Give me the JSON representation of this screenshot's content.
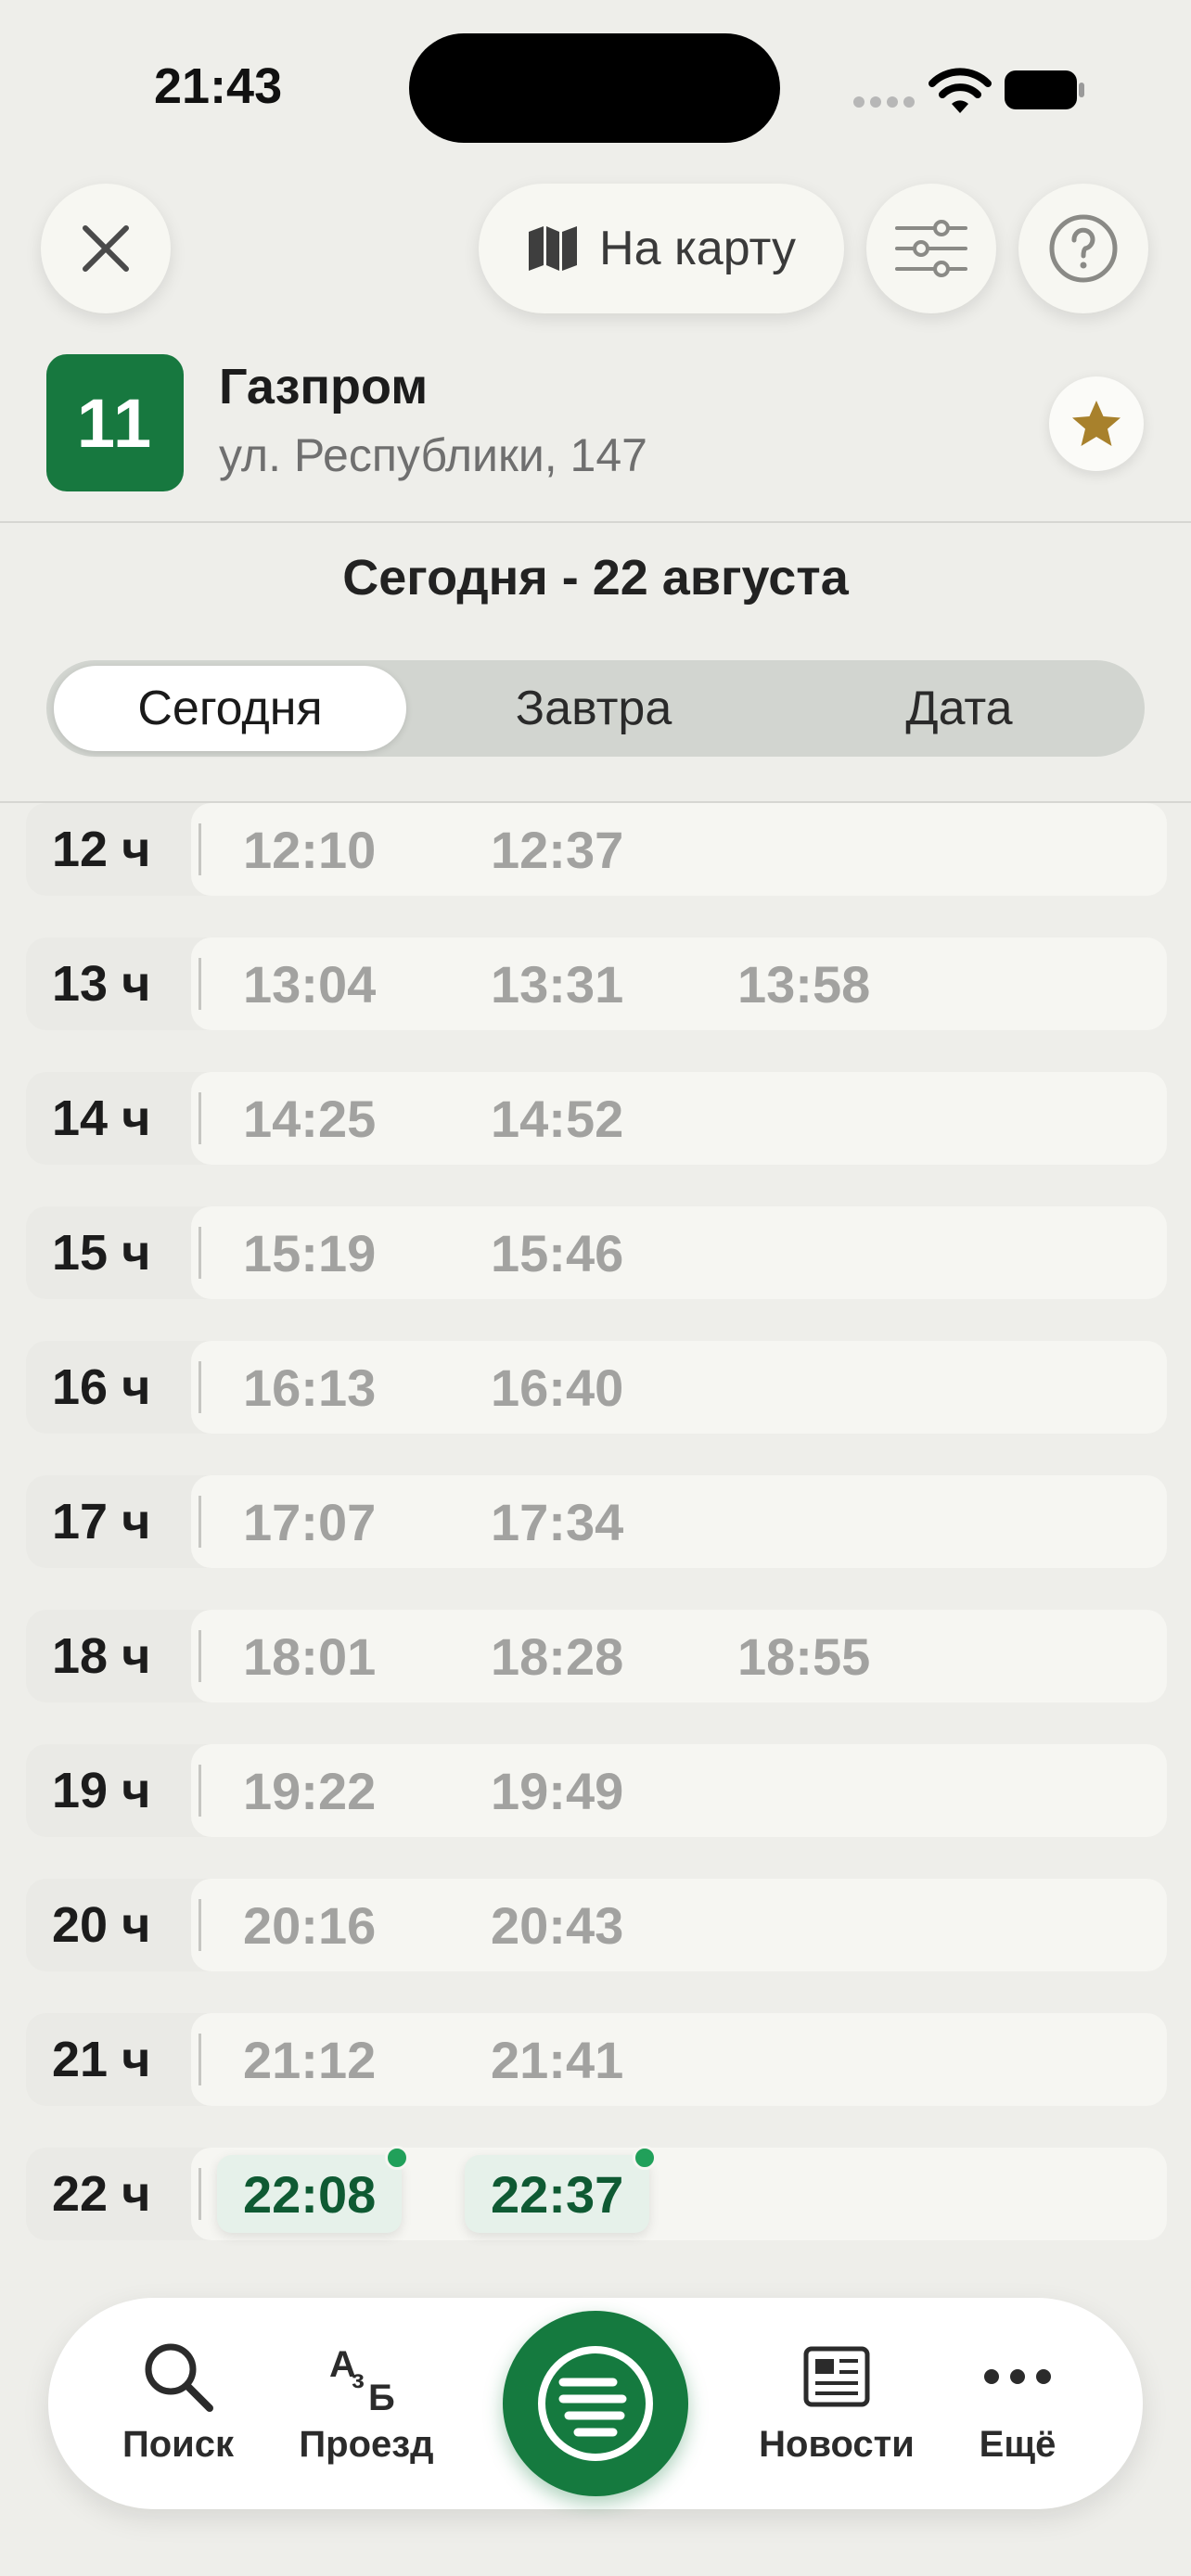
{
  "status_bar": {
    "time": "21:43",
    "signal_icon": "signal-icon",
    "wifi_icon": "wifi-icon",
    "battery_icon": "battery-icon"
  },
  "top_bar": {
    "close_icon": "close-icon",
    "map_button_label": "На карту",
    "map_icon": "map-icon",
    "filter_icon": "sliders-icon",
    "help_icon": "question-icon"
  },
  "stop": {
    "route_number": "11",
    "name": "Газпром",
    "address": "ул. Республики, 147",
    "favorite_icon": "star-icon"
  },
  "date_title": "Сегодня - 22 августа",
  "segments": {
    "selected": "Сегодня",
    "items": [
      "Сегодня",
      "Завтра",
      "Дата"
    ]
  },
  "schedule": [
    {
      "hour": "12 ч",
      "times": [
        "12:10",
        "12:37"
      ]
    },
    {
      "hour": "13 ч",
      "times": [
        "13:04",
        "13:31",
        "13:58"
      ]
    },
    {
      "hour": "14 ч",
      "times": [
        "14:25",
        "14:52"
      ]
    },
    {
      "hour": "15 ч",
      "times": [
        "15:19",
        "15:46"
      ]
    },
    {
      "hour": "16 ч",
      "times": [
        "16:13",
        "16:40"
      ]
    },
    {
      "hour": "17 ч",
      "times": [
        "17:07",
        "17:34"
      ]
    },
    {
      "hour": "18 ч",
      "times": [
        "18:01",
        "18:28",
        "18:55"
      ]
    },
    {
      "hour": "19 ч",
      "times": [
        "19:22",
        "19:49"
      ]
    },
    {
      "hour": "20 ч",
      "times": [
        "20:16",
        "20:43"
      ]
    },
    {
      "hour": "21 ч",
      "times": [
        "21:12",
        "21:41"
      ]
    },
    {
      "hour": "22 ч",
      "times": [
        "22:08",
        "22:37"
      ],
      "upcoming": true
    }
  ],
  "bottom_nav": {
    "items": [
      {
        "label": "Поиск",
        "icon": "search-icon"
      },
      {
        "label": "Проезд",
        "icon": "alphabet-icon"
      },
      {
        "label": "Новости",
        "icon": "newspaper-icon"
      },
      {
        "label": "Ещё",
        "icon": "more-dots-icon"
      }
    ],
    "center_icon": "app-logo-icon"
  },
  "colors": {
    "brand_green": "#17783f",
    "upcoming_text": "#0f5a33",
    "past_time": "#a2a2a0",
    "star": "#a8812c",
    "live_dot": "#21a05a"
  }
}
